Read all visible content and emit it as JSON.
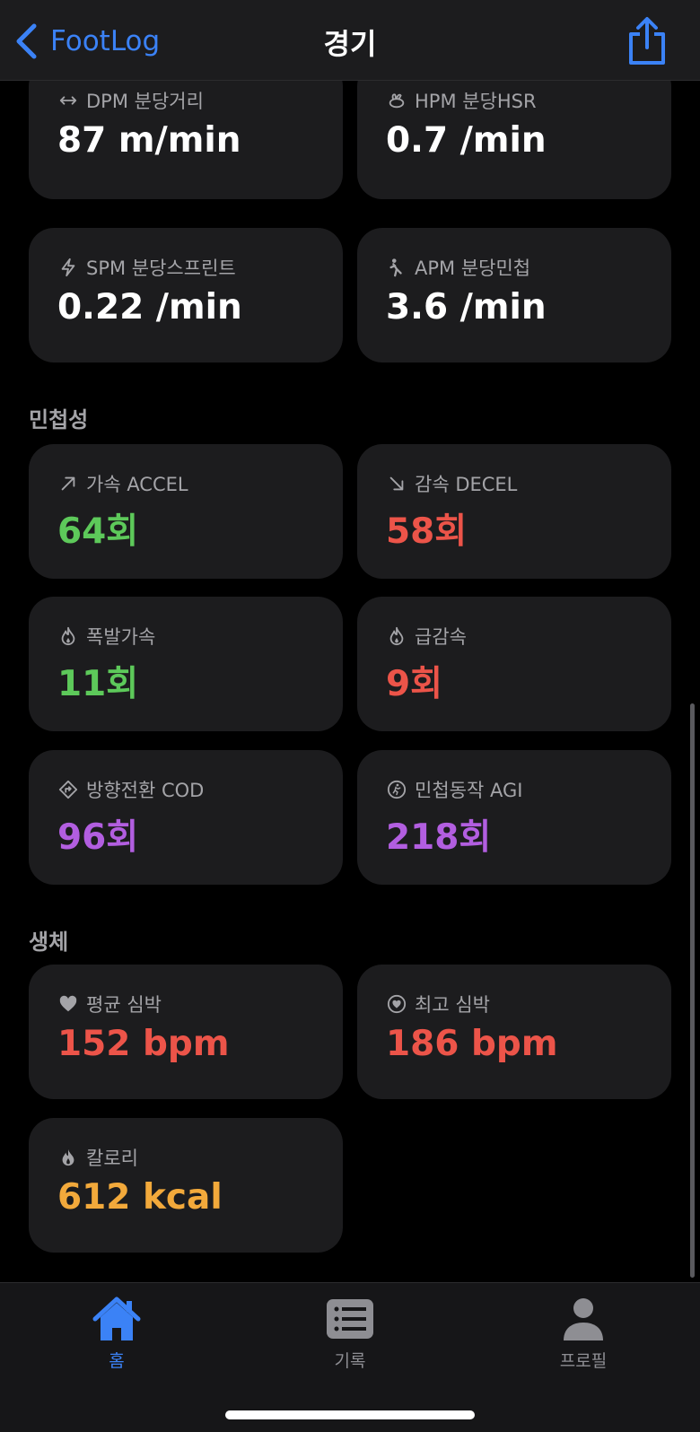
{
  "nav": {
    "back_label": "FootLog",
    "title": "경기"
  },
  "sections": [
    {
      "title": "민첩성"
    },
    {
      "title": "생체"
    }
  ],
  "cards": [
    {
      "icon": "arrows-horizontal-icon",
      "label": "DPM 분당거리",
      "value": "87 m/min",
      "color": "#ffffff"
    },
    {
      "icon": "rabbit-icon",
      "label": "HPM 분당HSR",
      "value": "0.7 /min",
      "color": "#ffffff"
    },
    {
      "icon": "bolt-icon",
      "label": "SPM 분당스프린트",
      "value": "0.22 /min",
      "color": "#ffffff"
    },
    {
      "icon": "figure-agile-icon",
      "label": "APM 분당민첩",
      "value": "3.6 /min",
      "color": "#ffffff"
    },
    {
      "icon": "arrow-up-right-icon",
      "label": "가속 ACCEL",
      "value": "64회",
      "color": "#5dc95a"
    },
    {
      "icon": "arrow-down-right-icon",
      "label": "감속 DECEL",
      "value": "58회",
      "color": "#ec5449"
    },
    {
      "icon": "flame-icon",
      "label": "폭발가속",
      "value": "11회",
      "color": "#5dc95a"
    },
    {
      "icon": "flame-icon",
      "label": "급감속",
      "value": "9회",
      "color": "#ec5449"
    },
    {
      "icon": "turn-diamond-icon",
      "label": "방향전환 COD",
      "value": "96회",
      "color": "#b25ee0"
    },
    {
      "icon": "running-circle-icon",
      "label": "민첩동작 AGI",
      "value": "218회",
      "color": "#b25ee0"
    },
    {
      "icon": "heart-icon",
      "label": "평균 심박",
      "value": "152 bpm",
      "color": "#ec5449"
    },
    {
      "icon": "heart-circle-icon",
      "label": "최고 심박",
      "value": "186 bpm",
      "color": "#ec5449"
    },
    {
      "icon": "flame-fill-icon",
      "label": "칼로리",
      "value": "612 kcal",
      "color": "#f2a93b"
    }
  ],
  "tabs": [
    {
      "label": "홈",
      "icon": "house-icon",
      "active": true
    },
    {
      "label": "기록",
      "icon": "list-icon",
      "active": false
    },
    {
      "label": "프로필",
      "icon": "person-icon",
      "active": false
    }
  ],
  "colors": {
    "accent": "#3b82f6",
    "card_bg": "#1c1c1e"
  }
}
